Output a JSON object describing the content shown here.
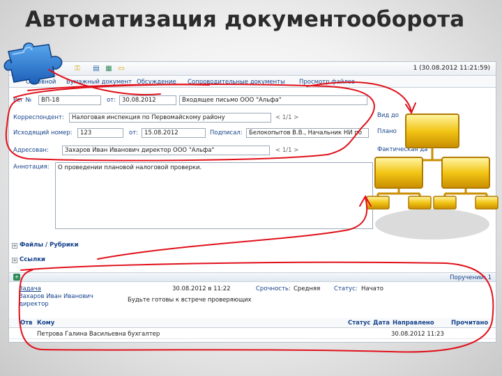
{
  "slide": {
    "title": "Автоматизация документооборота"
  },
  "toolbar": {
    "icons": [
      "key-icon",
      "save-icon",
      "tree-icon",
      "folder-icon"
    ],
    "status": "1   (30.08.2012 11:21:59)"
  },
  "tabs": [
    "Основной",
    "Бумажный документ",
    "Обсуждение",
    "Сопроводительные документы",
    "Просмотр файлов"
  ],
  "form": {
    "reg_label": "Рег №",
    "reg_value": "ВП-18",
    "from_label": "от:",
    "reg_date": "30.08.2012",
    "title_value": "Входящее письмо  ООО \"Альфа\"",
    "correspondent_label": "Корреспондент:",
    "correspondent_value": "Налоговая инспекция по Первомайскому району",
    "pager1": "< 1/1 >",
    "outgoing_label": "Исходящий номер:",
    "outgoing_value": "123",
    "from2_label": "от:",
    "outgoing_date": "15.08.2012",
    "signed_label": "Подписал:",
    "signed_value": "Белокопытов В.В., Начальник НИ по",
    "addressee_label": "Адресован:",
    "addressee_value": "Захаров Иван Иванович директор ООО \"Альфа\"",
    "pager2": "< 1/1 >",
    "annotation_label": "Аннотация:",
    "annotation_value": "О проведении плановой налоговой проверки.",
    "right_label1": "Вид до",
    "right_label2": "Плано",
    "right_label3": "Фактическая да"
  },
  "sections": {
    "files": "Файлы / Рубрики",
    "links": "Ссылки",
    "assignments": "Поручений: 1"
  },
  "task": {
    "type": "Задача",
    "datetime": "30.08.2012 в 11:22",
    "urgency_label": "Срочность:",
    "urgency_value": "Средняя",
    "status_label": "Статус:",
    "status_value": "Начато",
    "author": "Захаров Иван Иванович директор",
    "text": "Будьте готовы к встрече проверяющих"
  },
  "table": {
    "headers": [
      "Отв",
      "Кому",
      "Статус",
      "Дата",
      "Направлено",
      "Прочитано"
    ],
    "rows": [
      {
        "to": "Петрова Галина Васильевна бухгалтер",
        "sent": "30.08.2012 11:23"
      }
    ]
  }
}
